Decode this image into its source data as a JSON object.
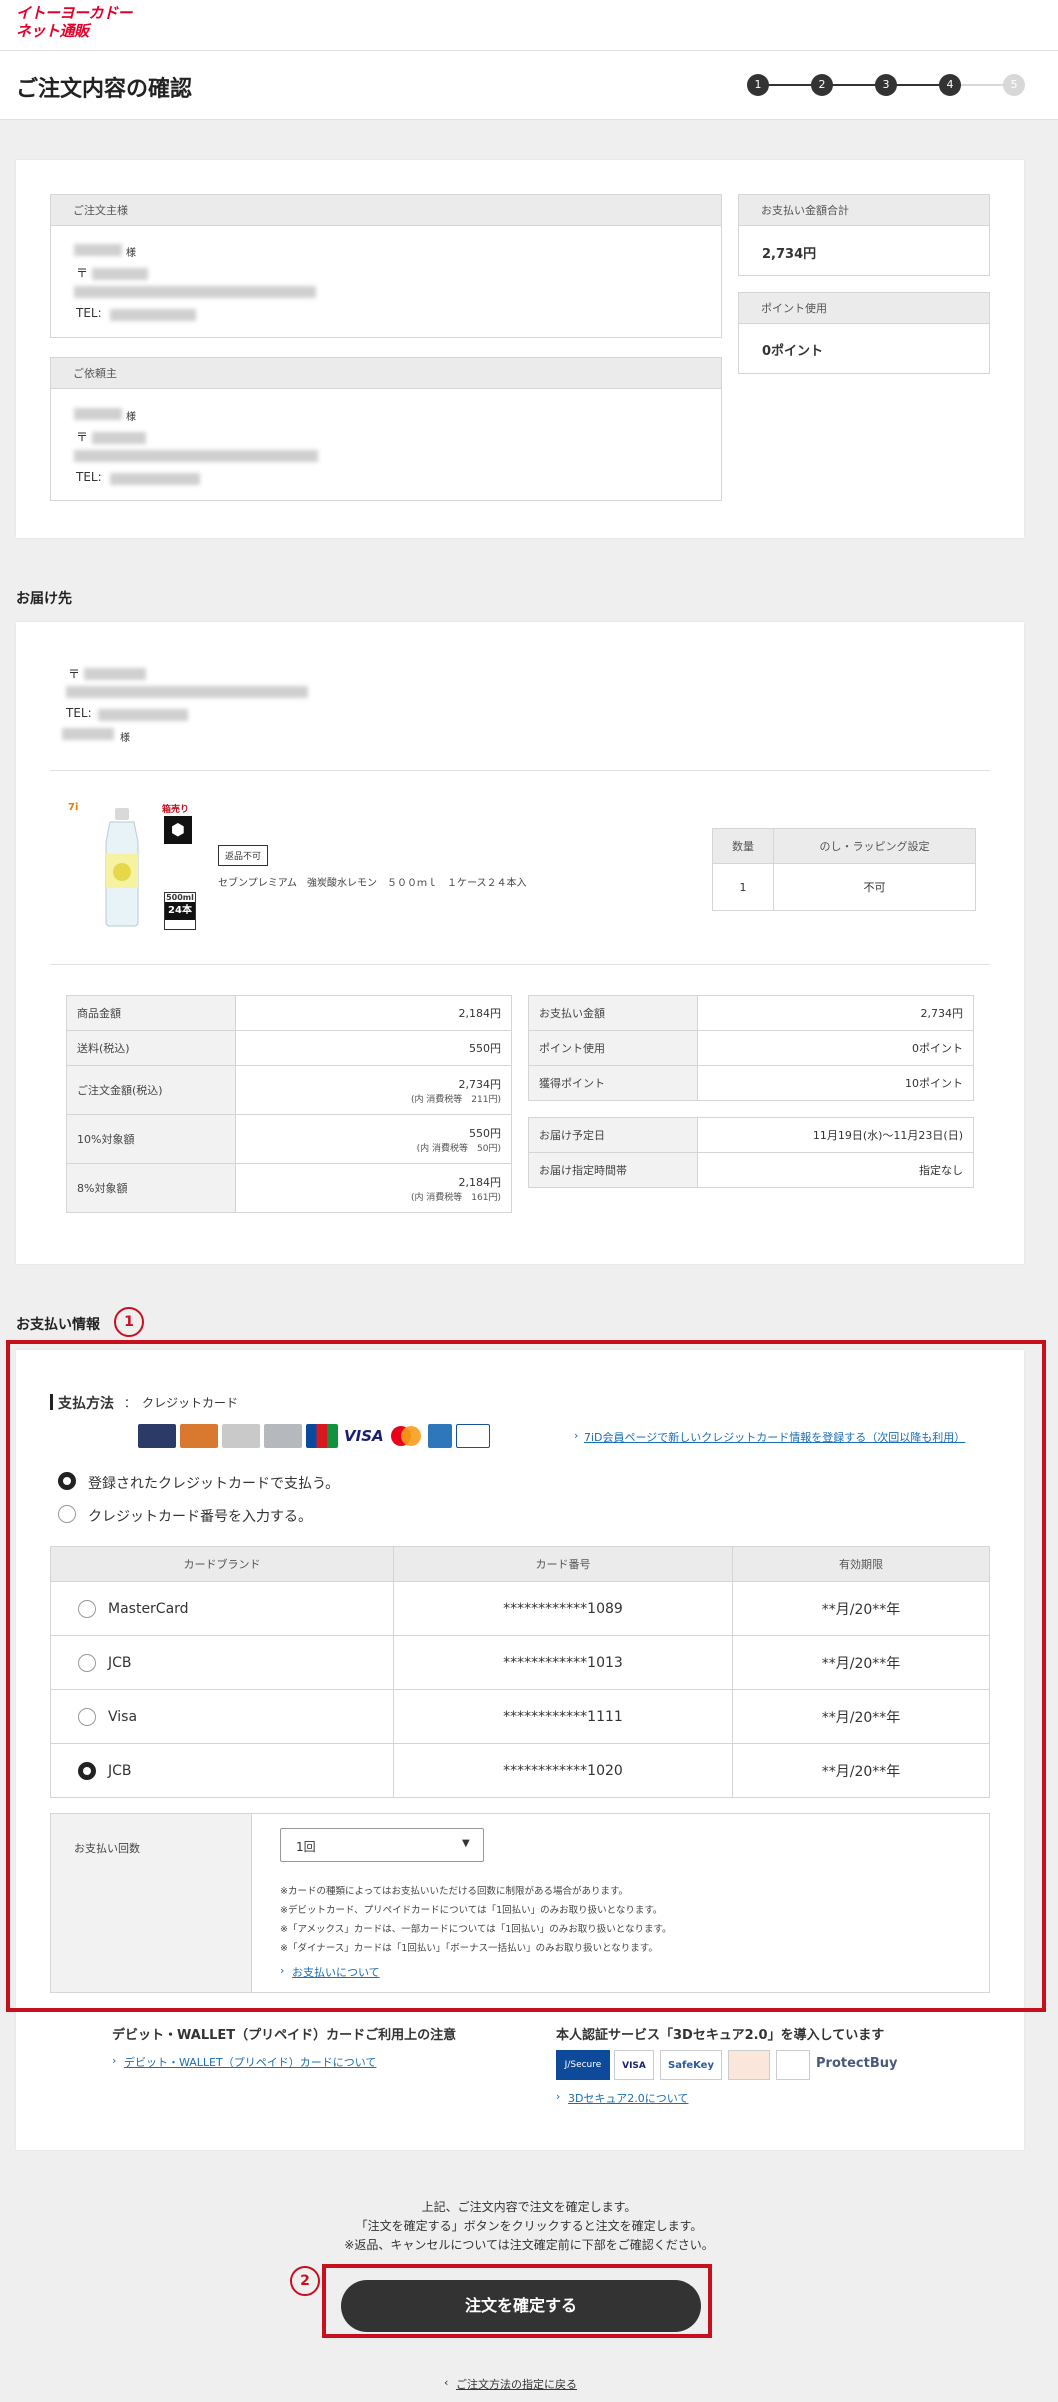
{
  "header": {
    "logo_line1": "イトーヨーカドー",
    "logo_line2": "ネット通販"
  },
  "page_title": "ご注文内容の確認",
  "steps": [
    "1",
    "2",
    "3",
    "4",
    "5"
  ],
  "orderer": {
    "head": "ご注文主様",
    "sama": "様",
    "postal": "〒",
    "tel": "TEL:"
  },
  "requester": {
    "head": "ご依頼主",
    "sama": "様",
    "postal": "〒",
    "tel": "TEL:"
  },
  "total": {
    "head": "お支払い金額合計",
    "value": "2,734円"
  },
  "points": {
    "head": "ポイント使用",
    "value": "0ポイント"
  },
  "delivery": {
    "title": "お届け先",
    "postal": "〒",
    "tel": "TEL:",
    "sama": "様"
  },
  "product": {
    "brand_badge": "7i",
    "pack_badge": "箱売り",
    "pack_icon": "cube-icon",
    "size_badge": "500ml",
    "count_badge": "24本",
    "return_tag": "返品不可",
    "name": "セブンプレミアム　強炭酸水レモン　５００ｍｌ　１ケース２４本入",
    "qty_head": "数量",
    "wrap_head": "のし・ラッピング設定",
    "qty": "1",
    "wrap": "不可"
  },
  "summary_left": [
    {
      "k": "商品金額",
      "v": "2,184円",
      "tax": ""
    },
    {
      "k": "送料(税込)",
      "v": "550円",
      "tax": ""
    },
    {
      "k": "ご注文金額(税込)",
      "v": "2,734円",
      "tax": "(内 消費税等　211円)"
    },
    {
      "k": "10%対象額",
      "v": "550円",
      "tax": "(内 消費税等　50円)"
    },
    {
      "k": "8%対象額",
      "v": "2,184円",
      "tax": "(内 消費税等　161円)"
    }
  ],
  "summary_right": [
    {
      "k": "お支払い金額",
      "v": "2,734円"
    },
    {
      "k": "ポイント使用",
      "v": "0ポイント"
    },
    {
      "k": "獲得ポイント",
      "v": "10ポイント"
    }
  ],
  "schedule": [
    {
      "k": "お届け予定日",
      "v": "11月19日(水)〜11月23日(日)"
    },
    {
      "k": "お届け指定時間帯",
      "v": "指定なし"
    }
  ],
  "payment": {
    "title": "お支払い情報",
    "badge1": "1",
    "method_label": "支払方法",
    "method_sep": "：",
    "method_value": "クレジットカード",
    "visa_text": "VISA",
    "register_link": "7iD会員ページで新しいクレジットカード情報を登録する（次回以降も利用）",
    "option_registered": "登録されたクレジットカードで支払う。",
    "option_new": "クレジットカード番号を入力する。",
    "table_head": [
      "カードブランド",
      "カード番号",
      "有効期限"
    ],
    "cards": [
      {
        "brand": "MasterCard",
        "number": "************1089",
        "expiry": "**月/20**年"
      },
      {
        "brand": "JCB",
        "number": "************1013",
        "expiry": "**月/20**年"
      },
      {
        "brand": "Visa",
        "number": "************1111",
        "expiry": "**月/20**年"
      },
      {
        "brand": "JCB",
        "number": "************1020",
        "expiry": "**月/20**年"
      }
    ],
    "installments_label": "お支払い回数",
    "installments_value": "1回",
    "notes": [
      "※カードの種類によってはお支払いいただける回数に制限がある場合があります。",
      "※デビットカード、プリペイドカードについては「1回払い」のみお取り扱いとなります。",
      "※「アメックス」カードは、一部カードについては「1回払い」のみお取り扱いとなります。",
      "※「ダイナース」カードは「1回払い」「ボーナス一括払い」のみお取り扱いとなります。"
    ],
    "about_link": "お支払いについて",
    "debit_title": "デビット・WALLET（プリペイド）カードご利用上の注意",
    "debit_link": "デビット・WALLET（プリペイド）カードについて",
    "secure_title": "本人認証サービス「3Dセキュア2.0」を導入しています",
    "secure_link": "3Dセキュア2.0について",
    "secure_logos": [
      "J/Secure",
      "VISA",
      "SafeKey",
      "",
      "ProtectBuy"
    ]
  },
  "confirm": {
    "text1": "上記、ご注文内容で注文を確定します。",
    "text2": "「注文を確定する」ボタンをクリックすると注文を確定します。",
    "text3": "※返品、キャンセルについては注文確定前に下部をご確認ください。",
    "badge2": "2",
    "button": "注文を確定する",
    "back_link": "ご注文方法の指定に戻る"
  }
}
